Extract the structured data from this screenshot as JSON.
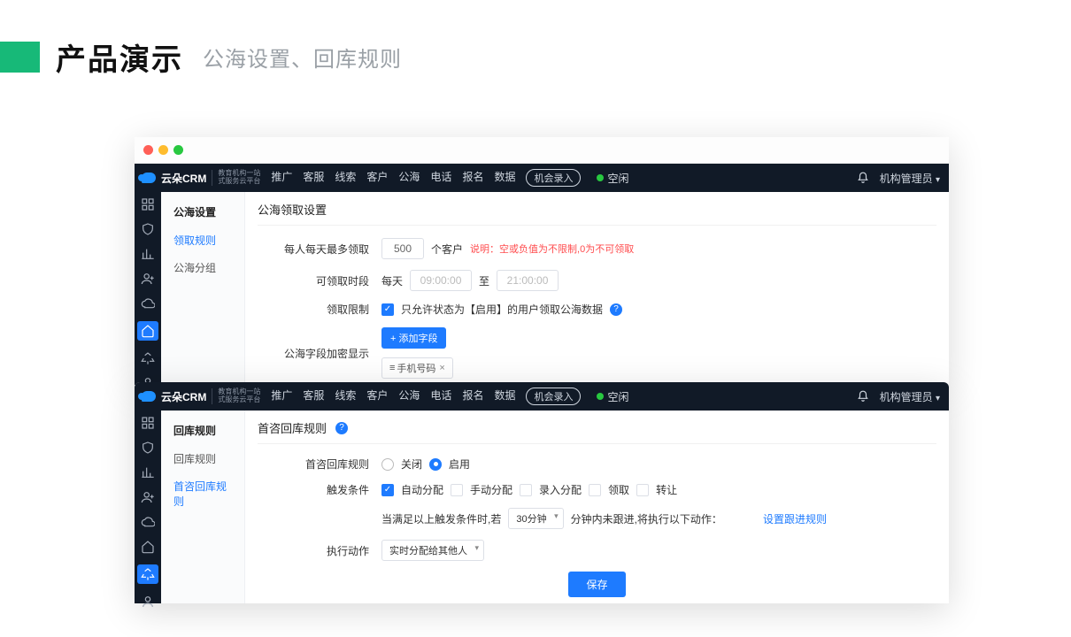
{
  "title": {
    "main": "产品演示",
    "sub": "公海设置、回库规则"
  },
  "nav": {
    "brand": "云朵CRM",
    "brand_sub1": "教育机构一站",
    "brand_sub2": "式服务云平台",
    "items": [
      "推广",
      "客服",
      "线索",
      "客户",
      "公海",
      "电话",
      "报名",
      "数据"
    ],
    "btn": "机会录入",
    "status": "空闲",
    "user": "机构管理员"
  },
  "panel1": {
    "side_title": "公海设置",
    "side_items": [
      "领取规则",
      "公海分组"
    ],
    "header": "公海领取设置",
    "row_limit": {
      "label": "每人每天最多领取",
      "value": "500",
      "unit": "个客户",
      "note_prefix": "说明：",
      "note": "空或负值为不限制,0为不可领取"
    },
    "row_time": {
      "label": "可领取时段",
      "prefix": "每天",
      "from": "09:00:00",
      "sep": "至",
      "to": "21:00:00"
    },
    "row_restrict": {
      "label": "领取限制",
      "text": "只允许状态为【启用】的用户领取公海数据"
    },
    "row_mask": {
      "label": "公海字段加密显示",
      "btn": "+ 添加字段",
      "tag": "手机号码"
    }
  },
  "panel2": {
    "side_title": "回库规则",
    "side_items": [
      "回库规则",
      "首咨回库规则"
    ],
    "header": "首咨回库规则",
    "row_rule": {
      "label": "首咨回库规则",
      "off": "关闭",
      "on": "启用"
    },
    "row_trigger": {
      "label": "触发条件",
      "opts": [
        "自动分配",
        "手动分配",
        "录入分配",
        "领取",
        "转让"
      ]
    },
    "row_cond": {
      "prefix": "当满足以上触发条件时,若",
      "select": "30分钟",
      "suffix": "分钟内未跟进,将执行以下动作：",
      "link": "设置跟进规则"
    },
    "row_action": {
      "label": "执行动作",
      "select": "实时分配给其他人"
    },
    "save": "保存"
  }
}
